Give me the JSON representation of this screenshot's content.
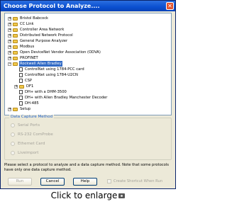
{
  "window": {
    "title": "Choose Protocol to Analyze....",
    "close_glyph": "✕"
  },
  "tree": {
    "items": [
      {
        "label": "Bristol Babcock",
        "kind": "folder",
        "expander": "+"
      },
      {
        "label": "CC Link",
        "kind": "folder",
        "expander": "+"
      },
      {
        "label": "Controller Area Network",
        "kind": "folder",
        "expander": "+"
      },
      {
        "label": "Distributed Network Protocol",
        "kind": "folder",
        "expander": "+"
      },
      {
        "label": "General Purpose Analyzer",
        "kind": "folder",
        "expander": "+"
      },
      {
        "label": "Modbus",
        "kind": "folder",
        "expander": "+"
      },
      {
        "label": "Open DeviceNet Vendor Association (ODVA)",
        "kind": "folder",
        "expander": "+"
      },
      {
        "label": "PROFINET",
        "kind": "folder",
        "expander": "+"
      },
      {
        "label": "Rockwell Allen Bradley",
        "kind": "folder",
        "expander": "−",
        "selected": true
      },
      {
        "label": "ControlNet using 1784-PCC card",
        "kind": "doc"
      },
      {
        "label": "ControlNet using 1784-U2CN",
        "kind": "doc"
      },
      {
        "label": "CSP",
        "kind": "doc"
      },
      {
        "label": "DF1",
        "kind": "folder",
        "expander": "+"
      },
      {
        "label": "DH+ with a DHM-3500",
        "kind": "doc"
      },
      {
        "label": "DH+ with Allen Bradley Manchester Decoder",
        "kind": "doc"
      },
      {
        "label": "DH-485",
        "kind": "doc"
      },
      {
        "label": "Setup",
        "kind": "folder",
        "expander": "+"
      }
    ]
  },
  "capture": {
    "title": "Data Capture Method",
    "options": [
      "Serial Ports",
      "RS-232 ComProbe",
      "Ethernet Card",
      "Liveimport"
    ]
  },
  "info_text": "Please select a protocol to analyze and a data capture method. Note that some protocols have only one data capture method.",
  "buttons": {
    "run": "Run",
    "cancel": "Cancel",
    "help": "Help"
  },
  "shortcut_label": "Create Shortcut When Run",
  "caption": "Click to enlarge",
  "colors": {
    "title_bar": "#0a4fd0",
    "selection": "#316ac5",
    "face": "#ece9d8"
  }
}
